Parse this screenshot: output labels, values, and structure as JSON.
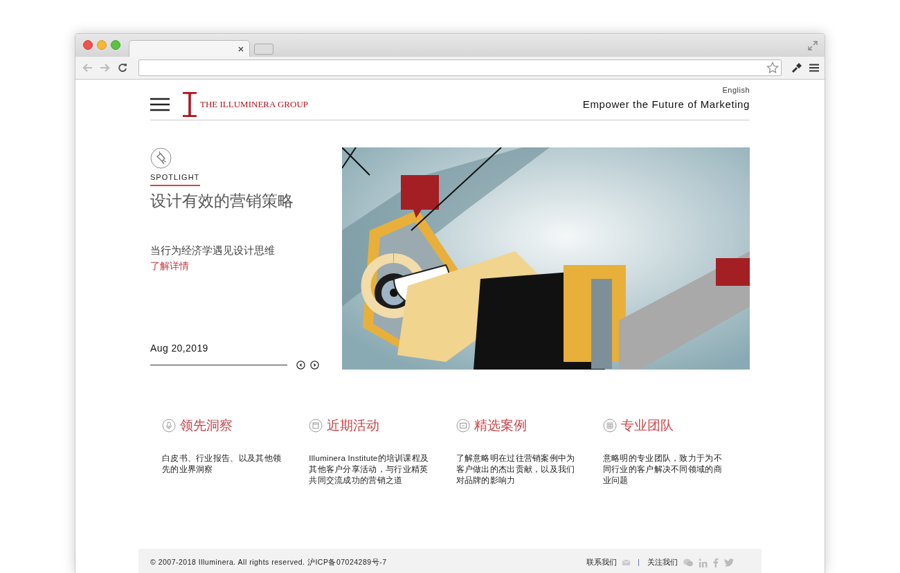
{
  "header": {
    "logo_text": "THE ILLUMINERA GROUP",
    "language": "English",
    "tagline": "Empower the Future of Marketing"
  },
  "spotlight": {
    "label": "SPOTLIGHT",
    "title": "设计有效的营销策略",
    "subtitle": "当行为经济学遇见设计思维",
    "link": "了解详情",
    "date": "Aug 20,2019"
  },
  "features": [
    {
      "kind": "mic",
      "title": "领先洞察",
      "description": "白皮书、行业报告、以及其他领先的业界洞察"
    },
    {
      "kind": "calendar",
      "title": "近期活动",
      "description": "Illuminera Institute的培训课程及其他客户分享活动，与行业精英共同交流成功的营销之道"
    },
    {
      "kind": "case",
      "title": "精选案例",
      "description": "了解意略明在过往营销案例中为客户做出的杰出贡献，以及我们对品牌的影响力"
    },
    {
      "kind": "grid",
      "title": "专业团队",
      "description": "意略明的专业团队，致力于为不同行业的客户解决不同领域的商业问题"
    }
  ],
  "footer": {
    "copyright": "© 2007-2018 Illuminera. All rights reserved. 沪ICP备07024289号-7",
    "contact": "联系我们",
    "follow": "关注我们"
  }
}
